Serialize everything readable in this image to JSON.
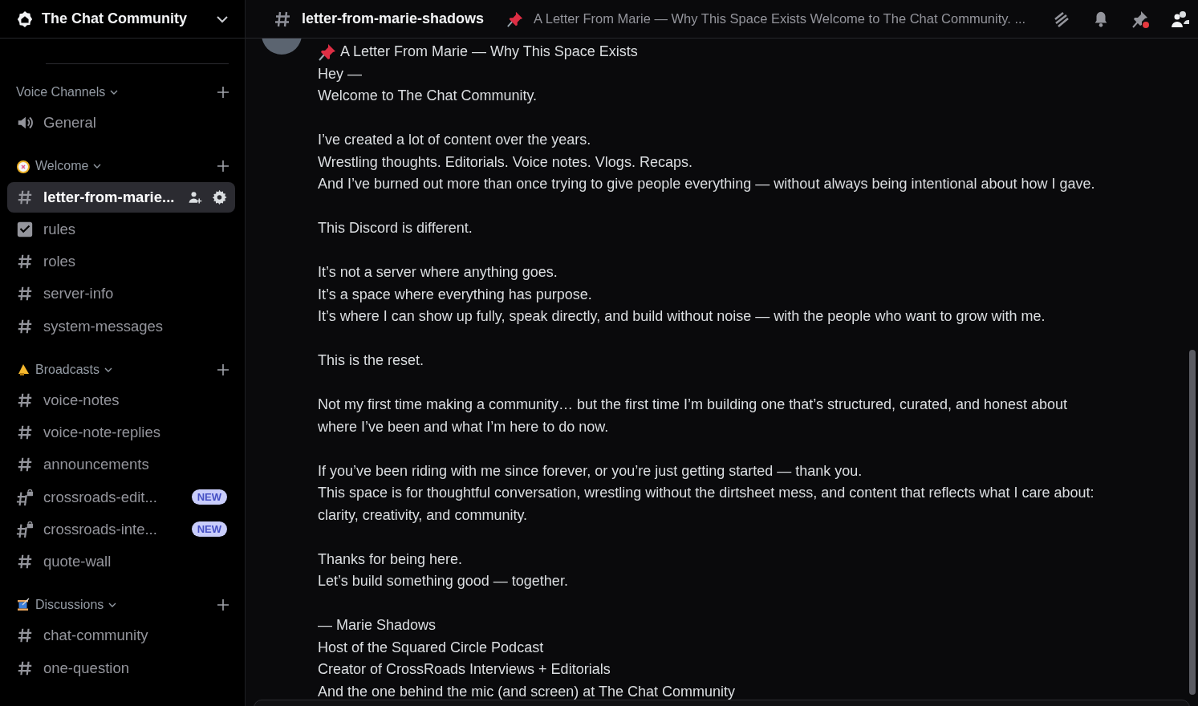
{
  "server": {
    "name": "The Chat Community"
  },
  "categories": [
    {
      "name": "Voice Channels",
      "kind": "plain",
      "channels": [
        {
          "name": "General",
          "kind": "voice",
          "selected": false
        }
      ]
    },
    {
      "name": "Welcome",
      "kind": "compass",
      "channels": [
        {
          "name": "letter-from-marie...",
          "kind": "text",
          "selected": true
        },
        {
          "name": "rules",
          "kind": "rules",
          "selected": false
        },
        {
          "name": "roles",
          "kind": "text",
          "selected": false
        },
        {
          "name": "server-info",
          "kind": "text",
          "selected": false
        },
        {
          "name": "system-messages",
          "kind": "text",
          "selected": false
        }
      ]
    },
    {
      "name": "Broadcasts",
      "kind": "megaphone",
      "channels": [
        {
          "name": "voice-notes",
          "kind": "text",
          "selected": false
        },
        {
          "name": "voice-note-replies",
          "kind": "text",
          "selected": false
        },
        {
          "name": "announcements",
          "kind": "text",
          "selected": false
        },
        {
          "name": "crossroads-edit...",
          "kind": "locked",
          "selected": false,
          "badge": "NEW"
        },
        {
          "name": "crossroads-inte...",
          "kind": "locked",
          "selected": false,
          "badge": "NEW"
        },
        {
          "name": "quote-wall",
          "kind": "text",
          "selected": false
        }
      ]
    },
    {
      "name": "Discussions",
      "kind": "spool",
      "channels": [
        {
          "name": "chat-community",
          "kind": "text",
          "selected": false
        },
        {
          "name": "one-question",
          "kind": "text",
          "selected": false
        }
      ]
    }
  ],
  "header": {
    "channel": "letter-from-marie-shadows",
    "topic": "A Letter From Marie — Why This Space Exists Welcome to The Chat Community. ..."
  },
  "message": {
    "title": "A Letter From Marie — Why This Space Exists",
    "paragraphs": [
      [
        "Hey —",
        "Welcome to The Chat Community."
      ],
      [
        "I’ve created a lot of content over the years.",
        "Wrestling thoughts. Editorials. Voice notes. Vlogs. Recaps.",
        "And I’ve burned out more than once trying to give people everything — without always being intentional about how I gave."
      ],
      [
        "This Discord is different."
      ],
      [
        "It’s not a server where anything goes.",
        "It’s a space where everything has purpose.",
        "It’s where I can show up fully, speak directly, and build without noise — with the people who want to grow with me."
      ],
      [
        "This is the reset."
      ],
      [
        "Not my first time making a community… but the first time I’m building one that’s structured, curated, and honest about",
        "where I’ve been and what I’m here to do now."
      ],
      [
        "If you’ve been riding with me since forever, or you’re just getting started — thank you.",
        "This space is for thoughtful conversation, wrestling without the dirtsheet mess, and content that reflects what I care about:",
        "clarity, creativity, and community."
      ],
      [
        "Thanks for being here.",
        "Let’s build something good — together."
      ],
      [
        "— Marie Shadows",
        "Host of the Squared Circle Podcast",
        "Creator of CrossRoads Interviews + Editorials",
        "And the one behind the mic (and screen) at The Chat Community"
      ]
    ]
  }
}
